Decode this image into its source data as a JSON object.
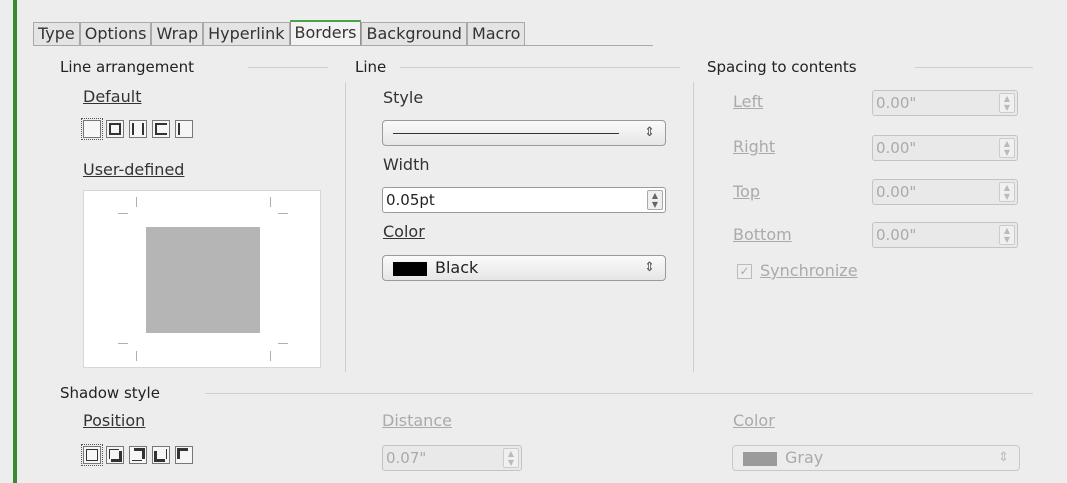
{
  "tabs": [
    "Type",
    "Options",
    "Wrap",
    "Hyperlink",
    "Borders",
    "Background",
    "Macro"
  ],
  "active_tab": "Borders",
  "line_arrangement": {
    "header": "Line arrangement",
    "default_label": "Default",
    "user_defined_label": "User-defined"
  },
  "line": {
    "header": "Line",
    "style_label": "Style",
    "width_label": "Width",
    "width_value": "0.05pt",
    "color_label": "Color",
    "color_value": "Black",
    "color_swatch": "#000000"
  },
  "spacing": {
    "header": "Spacing to contents",
    "left_label": "Left",
    "left_value": "0.00\"",
    "right_label": "Right",
    "right_value": "0.00\"",
    "top_label": "Top",
    "top_value": "0.00\"",
    "bottom_label": "Bottom",
    "bottom_value": "0.00\"",
    "synchronize_label": "Synchronize",
    "synchronize_checked": true
  },
  "shadow": {
    "header": "Shadow style",
    "position_label": "Position",
    "distance_label": "Distance",
    "distance_value": "0.07\"",
    "color_label": "Color",
    "color_value": "Gray",
    "color_swatch": "#808080"
  },
  "colors": {
    "accent": "#3a8a34",
    "active_tab_top": "#4aa24a",
    "disabled_text": "#aaaaaa"
  }
}
